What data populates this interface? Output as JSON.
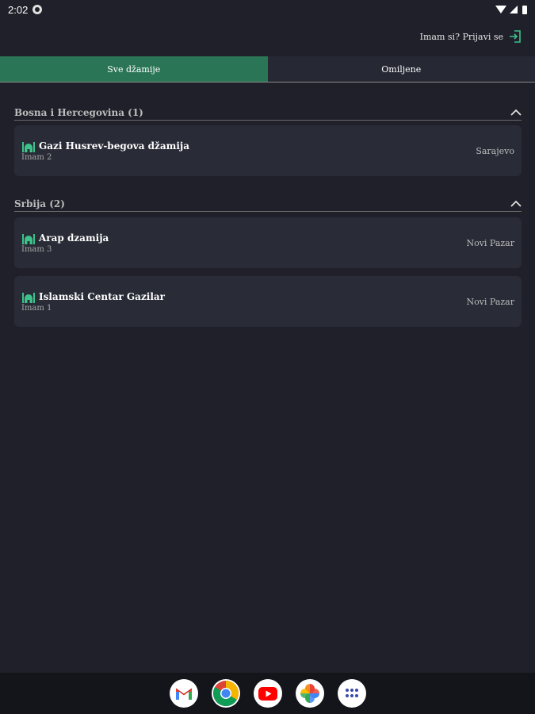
{
  "status": {
    "time": "2:02"
  },
  "header": {
    "login_label": "Imam si? Prijavi se"
  },
  "tabs": [
    {
      "label": "Sve džamije",
      "active": true
    },
    {
      "label": "Omiljene",
      "active": false
    }
  ],
  "sections": [
    {
      "title": "Bosna i Hercegovina (1)",
      "items": [
        {
          "name": "Gazi Husrev-begova džamija",
          "imam": "Imam 2",
          "city": "Sarajevo"
        }
      ]
    },
    {
      "title": "Srbija (2)",
      "items": [
        {
          "name": "Arap dzamija",
          "imam": "Imam 3",
          "city": "Novi Pazar"
        },
        {
          "name": "Islamski Centar Gazilar",
          "imam": "Imam 1",
          "city": "Novi Pazar"
        }
      ]
    }
  ],
  "colors": {
    "accent": "#2a7556",
    "icon_green": "#3cc28a",
    "background": "#1f2029",
    "card": "#292b36"
  },
  "dock": [
    "gmail-icon",
    "chrome-icon",
    "youtube-icon",
    "photos-icon",
    "app-drawer-icon"
  ]
}
